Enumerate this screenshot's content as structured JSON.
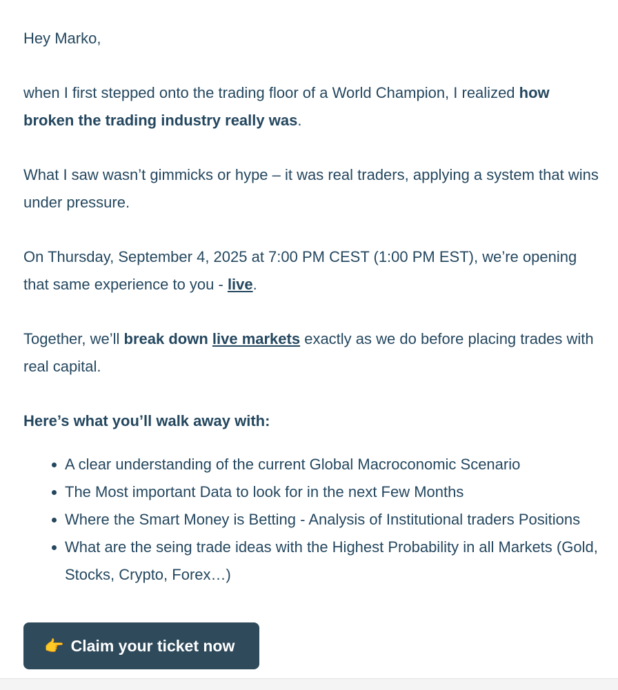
{
  "email": {
    "greeting": "Hey Marko,",
    "p1_text": "when I first stepped onto the trading floor of a World Champion, I realized ",
    "p1_bold": "how broken the trading industry really was",
    "p1_end": ".",
    "p2_text": "What I saw wasn’t gimmicks or hype – it was real traders, applying a system that wins under pressure.",
    "p3_text": "On Thursday, September 4, 2025 at 7:00 PM CEST (1:00 PM EST), we’re opening that same experience to you - ",
    "p3_link": "live",
    "p3_end": ".",
    "p4_start": "Together, we’ll ",
    "p4_bold": "break down ",
    "p4_link": "live markets",
    "p4_end": " exactly as we do before placing trades with real capital.",
    "benefits_heading": "Here’s what you’ll walk away with:",
    "benefits": [
      "A clear understanding of the current Global Macroconomic Scenario",
      "The Most important Data to look for in the next Few Months",
      "Where the Smart Money is Betting - Analysis of Institutional traders Positions",
      "What are the seing trade ideas with the Highest Probability in all Markets (Gold, Stocks, Crypto, Forex…)"
    ],
    "cta": {
      "icon": "pointing-hand-icon",
      "label": "Claim your ticket now"
    }
  },
  "colors": {
    "text": "#24475f",
    "button_bg": "#2f4a5b",
    "button_text": "#ffffff"
  }
}
